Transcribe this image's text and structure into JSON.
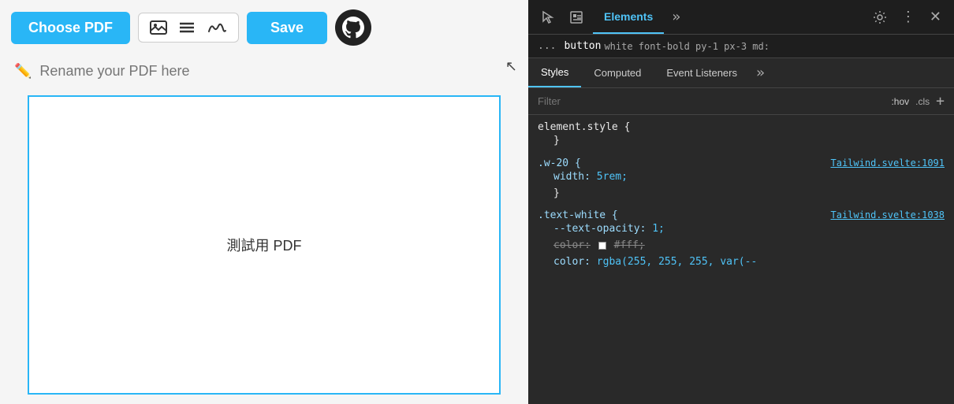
{
  "toolbar": {
    "choose_pdf_label": "Choose PDF",
    "save_label": "Save",
    "image_icon": "🖼",
    "lines_icon": "≡",
    "signature_icon": "𝓈"
  },
  "rename": {
    "placeholder": "Rename your PDF here"
  },
  "pdf": {
    "text": "測試用 PDF"
  },
  "devtools": {
    "breadcrumb_dots": "...",
    "breadcrumb_tag": "button",
    "breadcrumb_css": "white font-bold py-1 px-3 md:",
    "tab_elements": "Elements",
    "tab_styles": "Styles",
    "tab_computed": "Computed",
    "tab_event_listeners": "Event Listeners",
    "filter_placeholder": "Filter",
    "filter_hov": ":hov",
    "filter_cls": ".cls",
    "rule1_selector": "element.style {",
    "rule1_close": "}",
    "rule2_selector": ".w-20 {",
    "rule2_source": "Tailwind.svelte:1091",
    "rule2_prop": "width:",
    "rule2_val": "5rem;",
    "rule2_close": "}",
    "rule3_selector": ".text-white {",
    "rule3_source": "Tailwind.svelte:1038",
    "rule3_prop1": "--text-opacity:",
    "rule3_val1": "1;",
    "rule3_prop2_strike": "color:",
    "rule3_val2_strike": "#fff;",
    "rule3_prop3": "color:",
    "rule3_val3": "rgba(255, 255, 255, var(--"
  }
}
